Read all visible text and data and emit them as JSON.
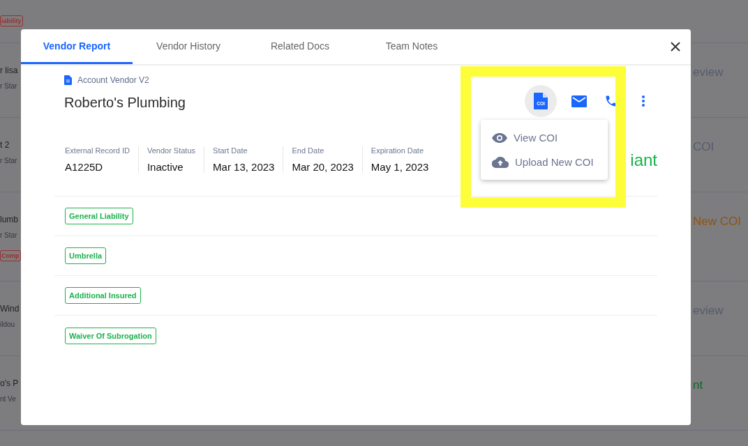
{
  "background_list": {
    "top_tag": {
      "label": "iability",
      "color": "#9a2f2f"
    },
    "rows": [
      {
        "title": "r lisa",
        "subtitle": "r Star",
        "status": {
          "label": "eview",
          "color": "#555b6e"
        }
      },
      {
        "title": "t 2",
        "subtitle": "r Star",
        "status": {
          "label": "COI",
          "color": "#555b6e"
        }
      },
      {
        "title": "lumb",
        "subtitle": "r Star",
        "tag": {
          "label": "Comp",
          "color": "#9a2f2f"
        },
        "status": {
          "label": "New COI",
          "color": "#8f5410"
        }
      },
      {
        "title": "Wind",
        "subtitle": "ildou",
        "status": {
          "label": "eview",
          "color": "#555b6e"
        }
      },
      {
        "title": "o's P",
        "subtitle": "nt Ve",
        "status": {
          "label": "nt",
          "color": "#13652e"
        }
      }
    ]
  },
  "modal": {
    "tabs": [
      {
        "label": "Vendor Report",
        "selected": true
      },
      {
        "label": "Vendor History",
        "selected": false
      },
      {
        "label": "Related Docs",
        "selected": false
      },
      {
        "label": "Team Notes",
        "selected": false
      }
    ],
    "record_type": "Account Vendor V2",
    "vendor_name": "Roberto's Plumbing",
    "actions": [
      {
        "kind": "coi",
        "label": "COI",
        "selected": true
      },
      {
        "kind": "mail",
        "selected": false
      },
      {
        "kind": "phone",
        "selected": false
      },
      {
        "kind": "more",
        "selected": false
      }
    ],
    "menu": [
      {
        "kind": "view",
        "label": "View COI"
      },
      {
        "kind": "upload",
        "label": "Upload New COI"
      }
    ],
    "fields": [
      {
        "label": "External Record ID",
        "value": "A1225D"
      },
      {
        "label": "Vendor Status",
        "value": "Inactive"
      },
      {
        "label": "Start Date",
        "value": "Mar 13, 2023"
      },
      {
        "label": "End Date",
        "value": "Mar 20, 2023"
      },
      {
        "label": "Expiration Date",
        "value": "May 1, 2023"
      }
    ],
    "compliance": "iant",
    "coverages": [
      "General Liability",
      "Umbrella",
      "Additional Insured",
      "Waiver Of Subrogation"
    ]
  }
}
